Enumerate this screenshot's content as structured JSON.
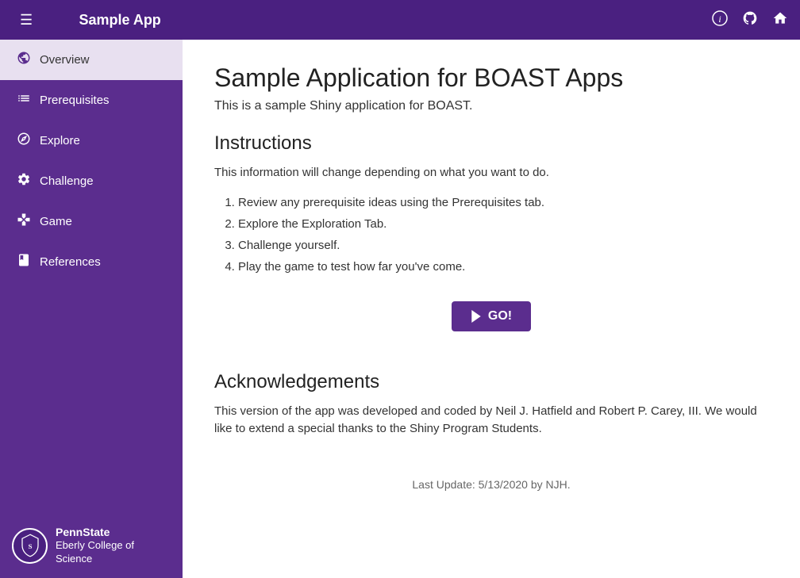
{
  "navbar": {
    "brand": "Sample App",
    "toggle_label": "☰",
    "icon_info": "ℹ",
    "icon_github": "⊙",
    "icon_home": "⌂"
  },
  "sidebar": {
    "items": [
      {
        "id": "overview",
        "label": "Overview",
        "icon": "globe",
        "active": true
      },
      {
        "id": "prerequisites",
        "label": "Prerequisites",
        "icon": "list",
        "active": false
      },
      {
        "id": "explore",
        "label": "Explore",
        "icon": "compass",
        "active": false
      },
      {
        "id": "challenge",
        "label": "Challenge",
        "icon": "gear",
        "active": false
      },
      {
        "id": "game",
        "label": "Game",
        "icon": "gamepad",
        "active": false
      },
      {
        "id": "references",
        "label": "References",
        "icon": "book",
        "active": false
      }
    ],
    "footer": {
      "university": "PennState",
      "college": "Eberly College of Science"
    }
  },
  "main": {
    "title": "Sample Application for BOAST Apps",
    "subtitle": "This is a sample Shiny application for BOAST.",
    "instructions_heading": "Instructions",
    "instructions_intro": "This information will change depending on what you want to do.",
    "instructions_list": [
      "Review any prerequisite ideas using the Prerequisites tab.",
      "Explore the Exploration Tab.",
      "Challenge yourself.",
      "Play the game to test how far you've come."
    ],
    "go_button_label": "GO!",
    "acknowledgements_heading": "Acknowledgements",
    "acknowledgements_text": "This version of the app was developed and coded by Neil J. Hatfield and Robert P. Carey, III. We would like to extend a special thanks to the Shiny Program Students.",
    "footer_update": "Last Update: 5/13/2020 by NJH."
  }
}
